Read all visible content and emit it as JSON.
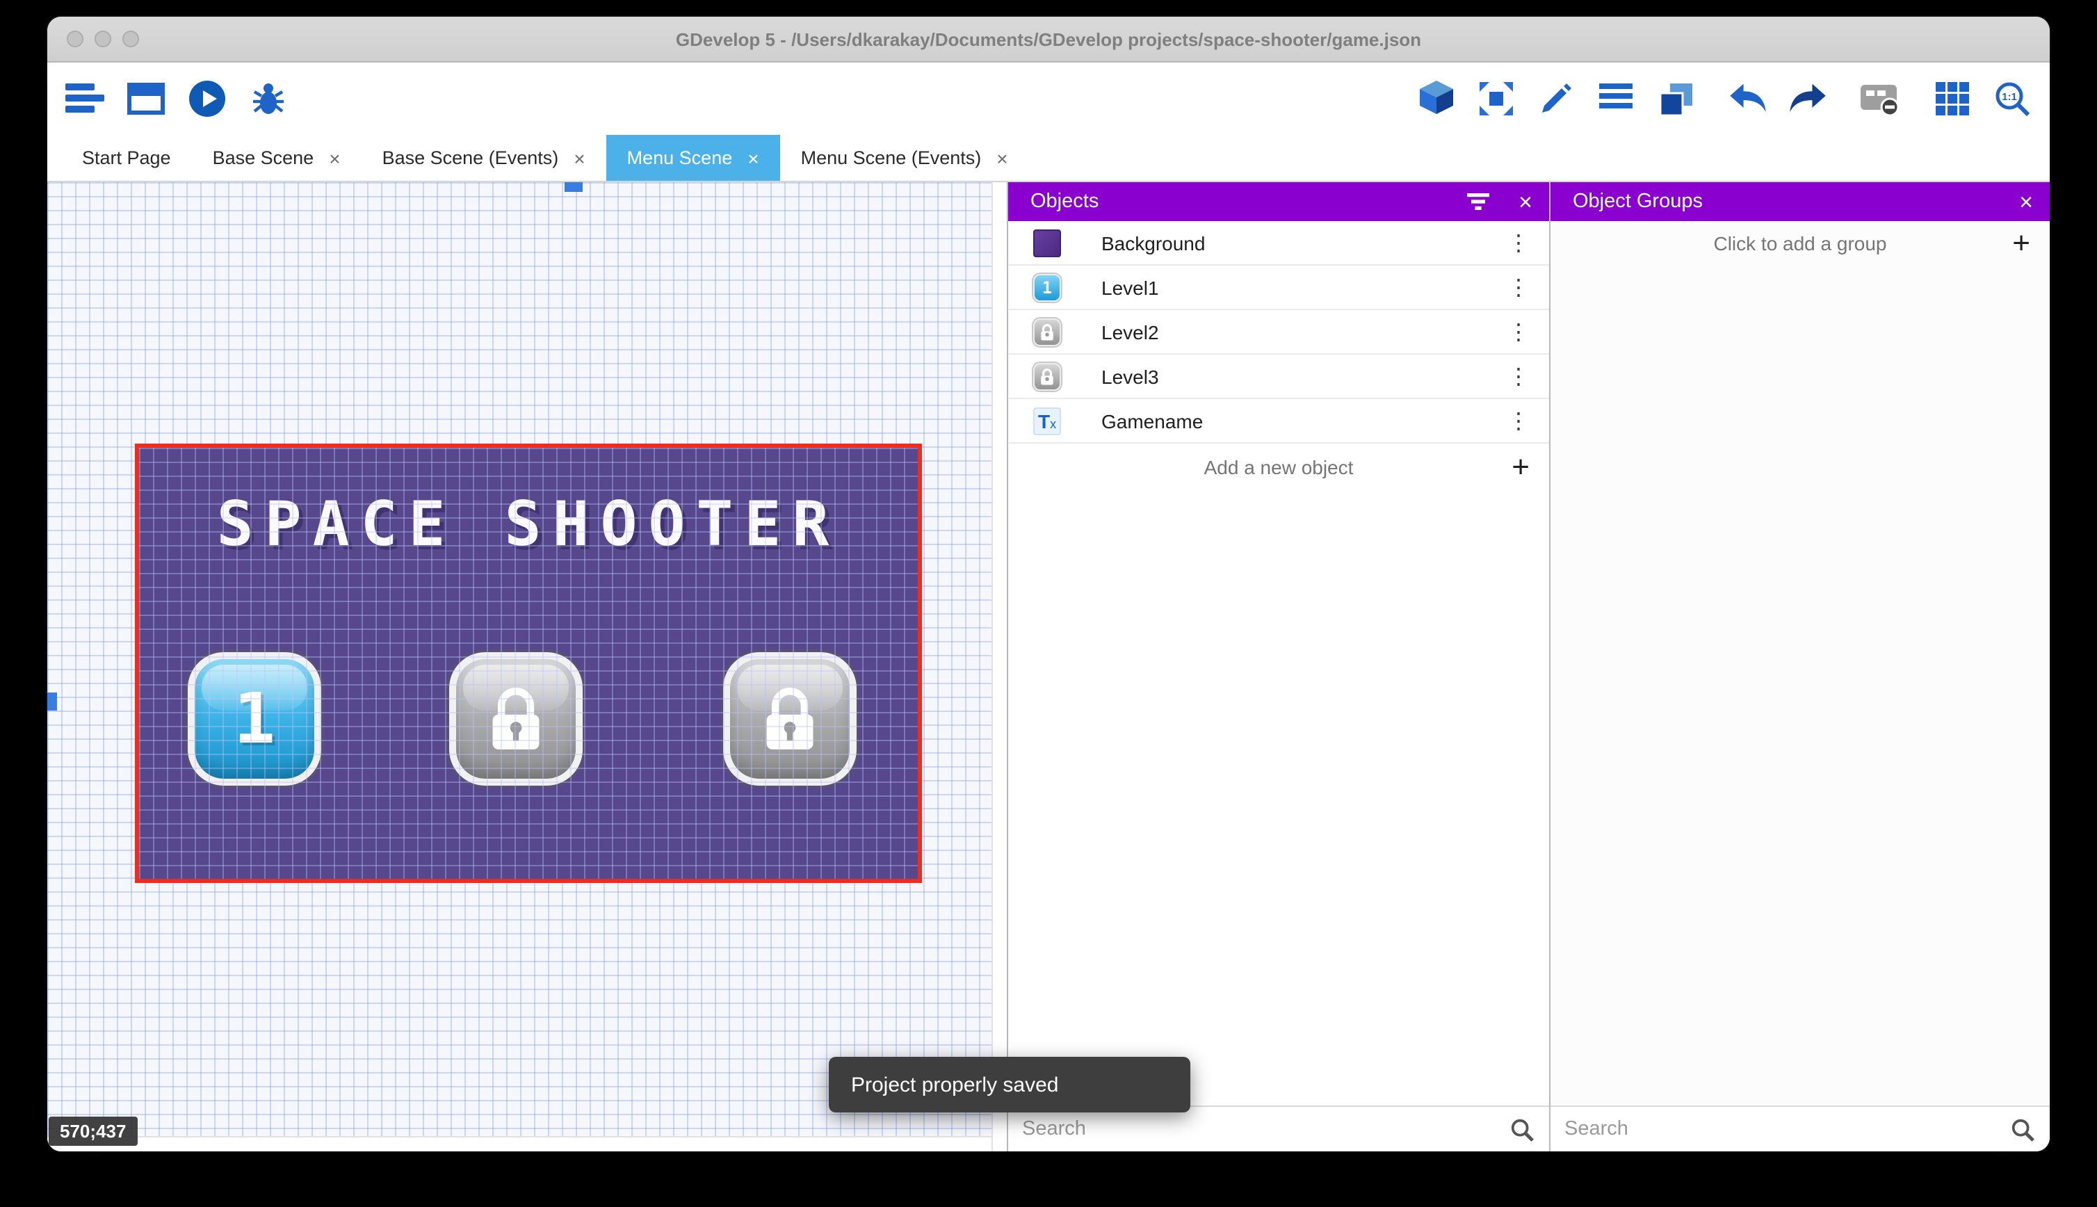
{
  "window": {
    "title": "GDevelop 5 - /Users/dkarakay/Documents/GDevelop projects/space-shooter/game.json"
  },
  "ui_glyphs": {
    "close": "×",
    "kebab": "⋮",
    "plus": "+"
  },
  "toolbar": {
    "left_icons": [
      "project-manager",
      "new-scene-window",
      "preview-play",
      "debug-bug"
    ],
    "right_icons": [
      "3d-box",
      "move-instances",
      "edit-pencil",
      "events-list",
      "layers",
      "undo",
      "redo",
      "render-frame",
      "grid",
      "zoom-1-1"
    ]
  },
  "tabs": [
    {
      "label": "Start Page",
      "closable": false,
      "active": false
    },
    {
      "label": "Base Scene",
      "closable": true,
      "active": false
    },
    {
      "label": "Base Scene (Events)",
      "closable": true,
      "active": false
    },
    {
      "label": "Menu Scene",
      "closable": true,
      "active": true
    },
    {
      "label": "Menu Scene (Events)",
      "closable": true,
      "active": false
    }
  ],
  "canvas": {
    "coordinates": "570;437",
    "scene": {
      "title": "SPACE SHOOTER",
      "level_buttons": [
        {
          "label": "1",
          "state": "unlocked"
        },
        {
          "label": "",
          "state": "locked"
        },
        {
          "label": "",
          "state": "locked"
        }
      ]
    }
  },
  "objects_panel": {
    "title": "Objects",
    "items": [
      {
        "name": "Background",
        "icon": "background-swatch"
      },
      {
        "name": "Level1",
        "icon": "level-button",
        "icon_label": "1"
      },
      {
        "name": "Level2",
        "icon": "lock-button"
      },
      {
        "name": "Level3",
        "icon": "lock-button"
      },
      {
        "name": "Gamename",
        "icon": "text-object",
        "icon_label": "T",
        "icon_sub": "x"
      }
    ],
    "add_label": "Add a new object",
    "search_placeholder": "Search"
  },
  "groups_panel": {
    "title": "Object Groups",
    "add_label": "Click to add a group",
    "search_placeholder": "Search"
  },
  "toast": {
    "message": "Project properly saved"
  },
  "colors": {
    "accent_purple": "#8a00ce",
    "active_tab_blue": "#4cb1e8",
    "selection_red": "#ee2d1f",
    "toolbar_blue": "#1e63c8",
    "toast_bg": "#3e3e3e"
  }
}
